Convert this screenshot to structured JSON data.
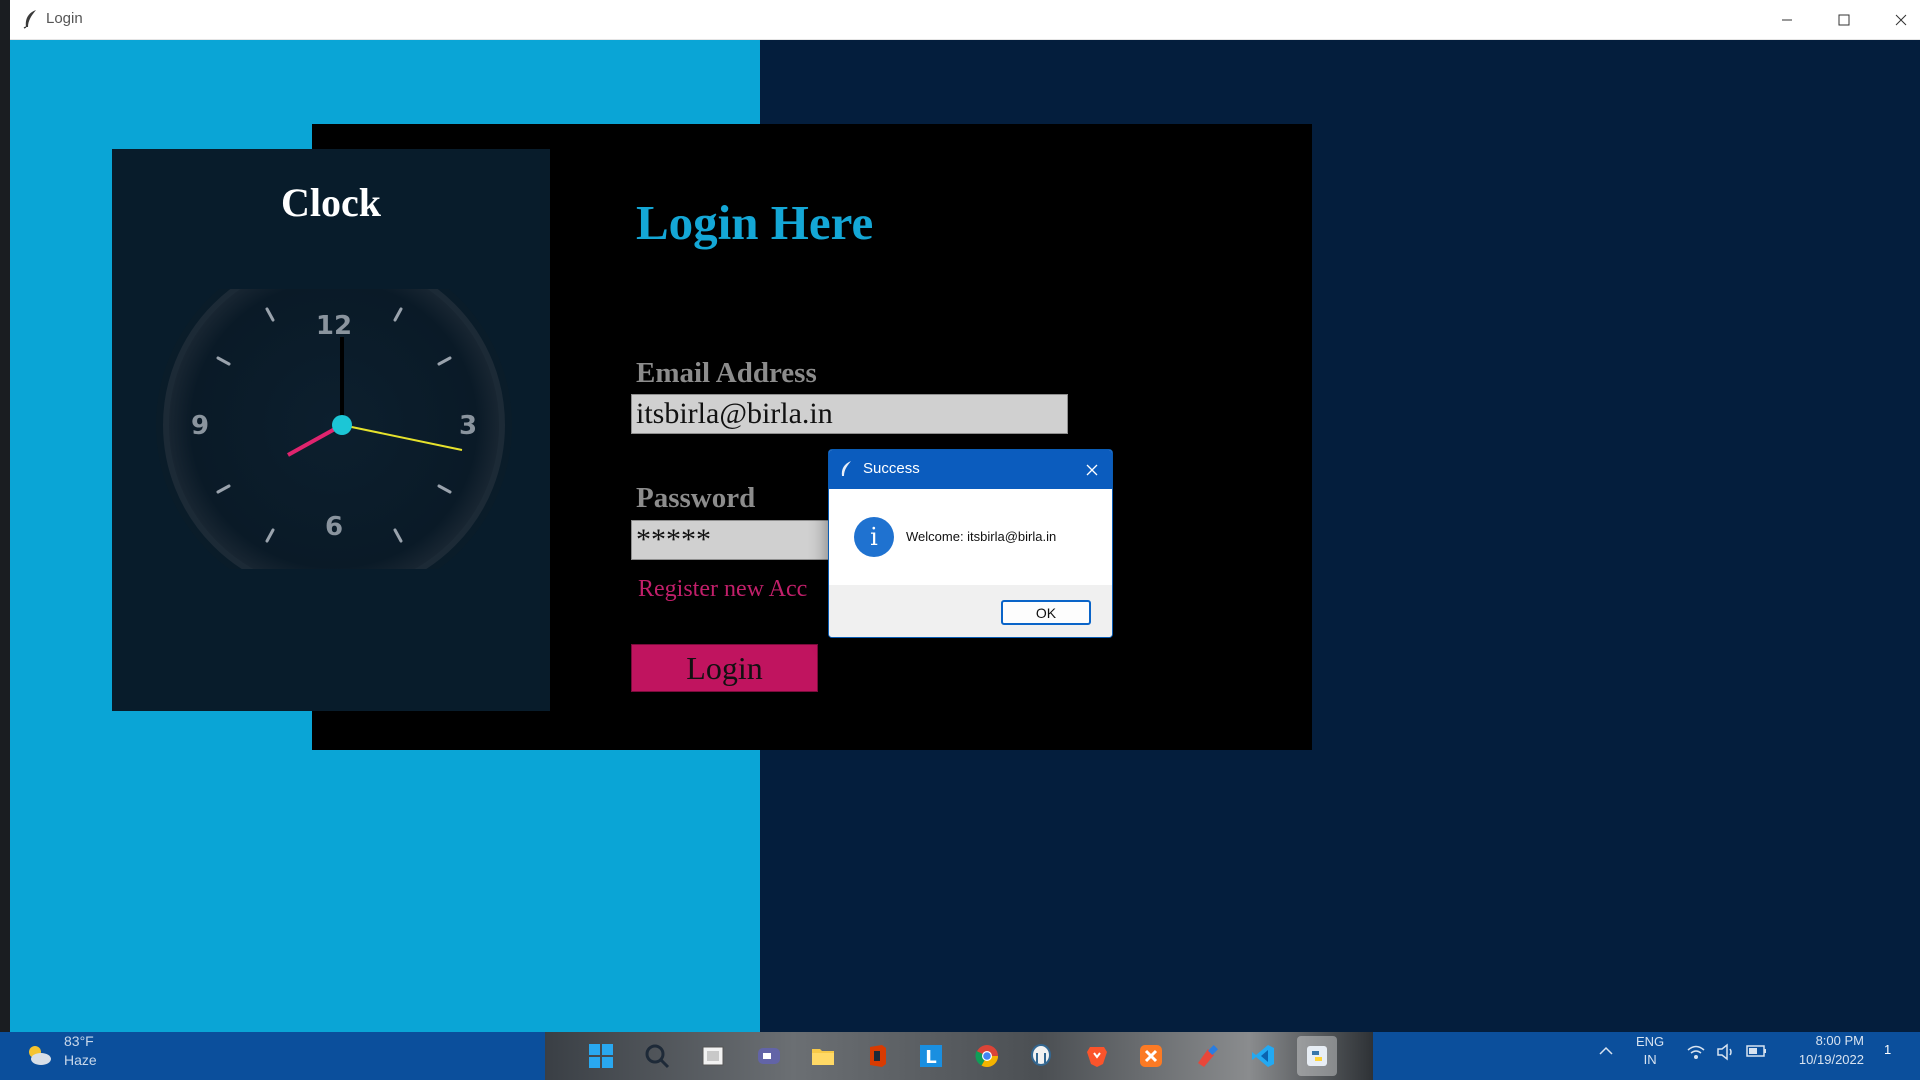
{
  "window": {
    "title": "Login"
  },
  "clock": {
    "title": "Clock",
    "numerals": {
      "twelve": "12",
      "three": "3",
      "six": "6",
      "nine": "9"
    },
    "hands": {
      "hour": "8",
      "minute": "0",
      "second": "17"
    }
  },
  "login": {
    "heading": "Login Here",
    "email_label": "Email Address",
    "email_value": "itsbirla@birla.in",
    "password_label": "Password",
    "password_value": "*****",
    "register_link": "Register new Acc",
    "login_button": "Login"
  },
  "dialog": {
    "title": "Success",
    "message": "Welcome: itsbirla@birla.in",
    "ok_button": "OK"
  },
  "taskbar": {
    "weather_temp": "83°F",
    "weather_desc": "Haze",
    "language_top": "ENG",
    "language_bottom": "IN",
    "time": "8:00 PM",
    "date": "10/19/2022",
    "notification_count": "1"
  },
  "colors": {
    "left_panel": "#0aa5d6",
    "right_panel": "#041e3d",
    "heading": "#14a7d6",
    "accent_pink": "#c0145f",
    "dialog_titlebar": "#0b5cbe"
  }
}
